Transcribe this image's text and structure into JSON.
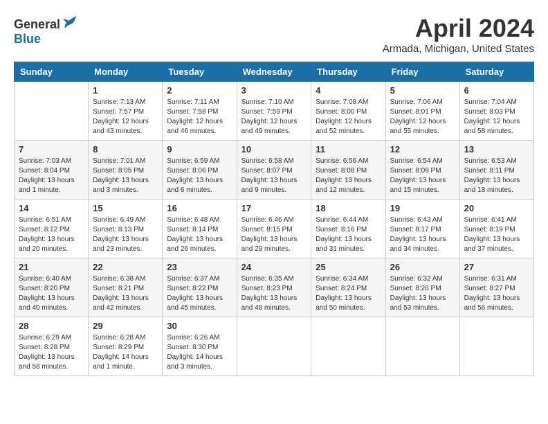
{
  "header": {
    "logo_general": "General",
    "logo_blue": "Blue",
    "title": "April 2024",
    "location": "Armada, Michigan, United States"
  },
  "days_of_week": [
    "Sunday",
    "Monday",
    "Tuesday",
    "Wednesday",
    "Thursday",
    "Friday",
    "Saturday"
  ],
  "weeks": [
    [
      {
        "day": "",
        "info": ""
      },
      {
        "day": "1",
        "info": "Sunrise: 7:13 AM\nSunset: 7:57 PM\nDaylight: 12 hours\nand 43 minutes."
      },
      {
        "day": "2",
        "info": "Sunrise: 7:11 AM\nSunset: 7:58 PM\nDaylight: 12 hours\nand 46 minutes."
      },
      {
        "day": "3",
        "info": "Sunrise: 7:10 AM\nSunset: 7:59 PM\nDaylight: 12 hours\nand 49 minutes."
      },
      {
        "day": "4",
        "info": "Sunrise: 7:08 AM\nSunset: 8:00 PM\nDaylight: 12 hours\nand 52 minutes."
      },
      {
        "day": "5",
        "info": "Sunrise: 7:06 AM\nSunset: 8:01 PM\nDaylight: 12 hours\nand 55 minutes."
      },
      {
        "day": "6",
        "info": "Sunrise: 7:04 AM\nSunset: 8:03 PM\nDaylight: 12 hours\nand 58 minutes."
      }
    ],
    [
      {
        "day": "7",
        "info": "Sunrise: 7:03 AM\nSunset: 8:04 PM\nDaylight: 13 hours\nand 1 minute."
      },
      {
        "day": "8",
        "info": "Sunrise: 7:01 AM\nSunset: 8:05 PM\nDaylight: 13 hours\nand 3 minutes."
      },
      {
        "day": "9",
        "info": "Sunrise: 6:59 AM\nSunset: 8:06 PM\nDaylight: 13 hours\nand 6 minutes."
      },
      {
        "day": "10",
        "info": "Sunrise: 6:58 AM\nSunset: 8:07 PM\nDaylight: 13 hours\nand 9 minutes."
      },
      {
        "day": "11",
        "info": "Sunrise: 6:56 AM\nSunset: 8:08 PM\nDaylight: 13 hours\nand 12 minutes."
      },
      {
        "day": "12",
        "info": "Sunrise: 6:54 AM\nSunset: 8:09 PM\nDaylight: 13 hours\nand 15 minutes."
      },
      {
        "day": "13",
        "info": "Sunrise: 6:53 AM\nSunset: 8:11 PM\nDaylight: 13 hours\nand 18 minutes."
      }
    ],
    [
      {
        "day": "14",
        "info": "Sunrise: 6:51 AM\nSunset: 8:12 PM\nDaylight: 13 hours\nand 20 minutes."
      },
      {
        "day": "15",
        "info": "Sunrise: 6:49 AM\nSunset: 8:13 PM\nDaylight: 13 hours\nand 23 minutes."
      },
      {
        "day": "16",
        "info": "Sunrise: 6:48 AM\nSunset: 8:14 PM\nDaylight: 13 hours\nand 26 minutes."
      },
      {
        "day": "17",
        "info": "Sunrise: 6:46 AM\nSunset: 8:15 PM\nDaylight: 13 hours\nand 29 minutes."
      },
      {
        "day": "18",
        "info": "Sunrise: 6:44 AM\nSunset: 8:16 PM\nDaylight: 13 hours\nand 31 minutes."
      },
      {
        "day": "19",
        "info": "Sunrise: 6:43 AM\nSunset: 8:17 PM\nDaylight: 13 hours\nand 34 minutes."
      },
      {
        "day": "20",
        "info": "Sunrise: 6:41 AM\nSunset: 8:19 PM\nDaylight: 13 hours\nand 37 minutes."
      }
    ],
    [
      {
        "day": "21",
        "info": "Sunrise: 6:40 AM\nSunset: 8:20 PM\nDaylight: 13 hours\nand 40 minutes."
      },
      {
        "day": "22",
        "info": "Sunrise: 6:38 AM\nSunset: 8:21 PM\nDaylight: 13 hours\nand 42 minutes."
      },
      {
        "day": "23",
        "info": "Sunrise: 6:37 AM\nSunset: 8:22 PM\nDaylight: 13 hours\nand 45 minutes."
      },
      {
        "day": "24",
        "info": "Sunrise: 6:35 AM\nSunset: 8:23 PM\nDaylight: 13 hours\nand 48 minutes."
      },
      {
        "day": "25",
        "info": "Sunrise: 6:34 AM\nSunset: 8:24 PM\nDaylight: 13 hours\nand 50 minutes."
      },
      {
        "day": "26",
        "info": "Sunrise: 6:32 AM\nSunset: 8:26 PM\nDaylight: 13 hours\nand 53 minutes."
      },
      {
        "day": "27",
        "info": "Sunrise: 6:31 AM\nSunset: 8:27 PM\nDaylight: 13 hours\nand 56 minutes."
      }
    ],
    [
      {
        "day": "28",
        "info": "Sunrise: 6:29 AM\nSunset: 8:28 PM\nDaylight: 13 hours\nand 58 minutes."
      },
      {
        "day": "29",
        "info": "Sunrise: 6:28 AM\nSunset: 8:29 PM\nDaylight: 14 hours\nand 1 minute."
      },
      {
        "day": "30",
        "info": "Sunrise: 6:26 AM\nSunset: 8:30 PM\nDaylight: 14 hours\nand 3 minutes."
      },
      {
        "day": "",
        "info": ""
      },
      {
        "day": "",
        "info": ""
      },
      {
        "day": "",
        "info": ""
      },
      {
        "day": "",
        "info": ""
      }
    ]
  ]
}
